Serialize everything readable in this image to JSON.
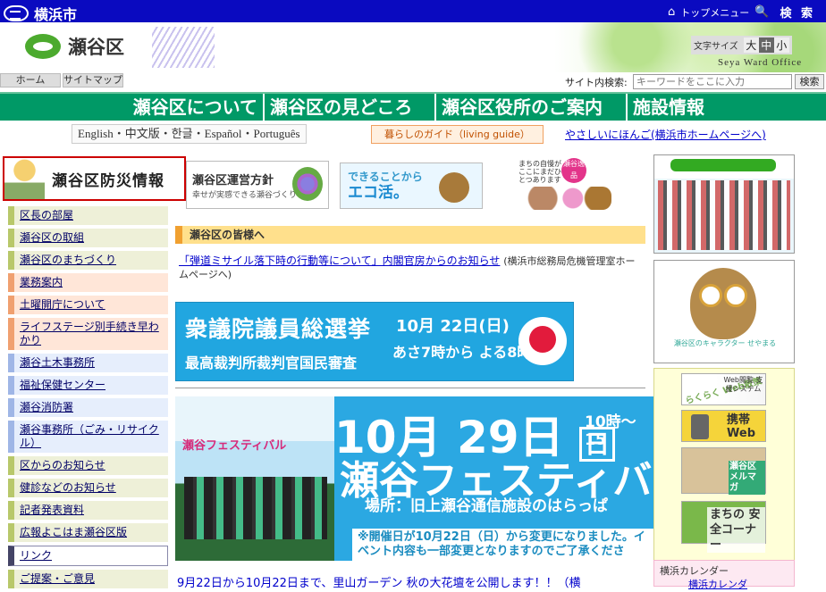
{
  "topbar": {
    "city": "横浜市",
    "top_menu": "トップメニュー",
    "search": "検 索"
  },
  "header": {
    "ward_name": "瀬谷区",
    "font_size_label": "文字サイズ",
    "font_sizes": [
      "大",
      "中",
      "小"
    ],
    "english_name": "Seya Ward Office"
  },
  "utility": {
    "home": "ホーム",
    "sitemap": "サイトマップ",
    "site_search_label": "サイト内検索:",
    "search_placeholder": "キーワードをここに入力",
    "search_button": "検索"
  },
  "global_nav": [
    "瀬谷区について",
    "瀬谷区の見どころ",
    "瀬谷区役所のご案内",
    "施設情報"
  ],
  "subnav": {
    "languages": "English・中文版・한글・Español・Português",
    "living_guide": "暮らしのガイド（living guide）",
    "easy_japanese": "やさしいにほんご(横浜市ホームページへ)"
  },
  "disaster_banner": "瀬谷区防災情報",
  "left_nav": [
    {
      "label": "区長の部屋",
      "style": "g"
    },
    {
      "label": "瀬谷区の取組",
      "style": "g"
    },
    {
      "label": "瀬谷区のまちづくり",
      "style": "g"
    },
    {
      "label": "業務案内",
      "style": "o"
    },
    {
      "label": "土曜開庁について",
      "style": "o"
    },
    {
      "label": "ライフステージ別手続き早わかり",
      "style": "o"
    },
    {
      "label": "瀬谷土木事務所",
      "style": "b"
    },
    {
      "label": "福祉保健センター",
      "style": "b"
    },
    {
      "label": "瀬谷消防署",
      "style": "b"
    },
    {
      "label": "瀬谷事務所（ごみ・リサイクル）",
      "style": "b"
    },
    {
      "label": "区からのお知らせ",
      "style": "g"
    },
    {
      "label": "健診などのお知らせ",
      "style": "g"
    },
    {
      "label": "記者発表資料",
      "style": "g"
    },
    {
      "label": "広報よこはま瀬谷区版",
      "style": "g"
    },
    {
      "label": "リンク",
      "style": "w"
    },
    {
      "label": "ご提案・ご意見",
      "style": "g"
    }
  ],
  "banners": {
    "policy_title": "瀬谷区運営方針",
    "policy_sub": "幸せが実感できる瀬谷づくり",
    "eco_line1": "できることから",
    "eco_line2": "エコ活。",
    "machi_text": "まちの自慢がここにまだひとつあります",
    "machi_badge": "瀬谷逸品"
  },
  "notice_header": "瀬谷区の皆様へ",
  "news1": {
    "link": "「弾道ミサイル落下時の行動等について」内閣官房からのお知らせ",
    "source": "(横浜市総務局危機管理室ホームページへ)"
  },
  "election": {
    "title": "衆議院議員総選挙",
    "subtitle": "最高裁判所裁判官国民審査",
    "date": "10月 22日(日)",
    "hours": "あさ7時から よる8時"
  },
  "festival": {
    "date_main": "10月 29日",
    "date_day": "日",
    "time": "10時～15",
    "title": "瀬谷フェスティバ",
    "place": "場所：旧上瀬谷通信施設のはらっぱ",
    "notice": "※開催日が10月22日（日）から変更になりました。イベント内容も一部変更となりますのでご了承くださ",
    "photo_label": "瀬谷フェスティバル"
  },
  "news2": "9月22日から10月22日まで、里山ガーデン 秋の大花壇を公開します！！（横",
  "right": {
    "mascot_caption": "瀬谷区のキャラクター せやまる",
    "web_sanpo": "らくらく Web散策",
    "web_sanpo_sub": "Web閲覧 支援システム",
    "mobile": "携帯 Web",
    "mailmag": "瀬谷区 メルマガ",
    "safety": "まちの 安全コーナー",
    "calendar_title": "横浜カレンダー",
    "calendar_link": "横浜カレンダ"
  }
}
